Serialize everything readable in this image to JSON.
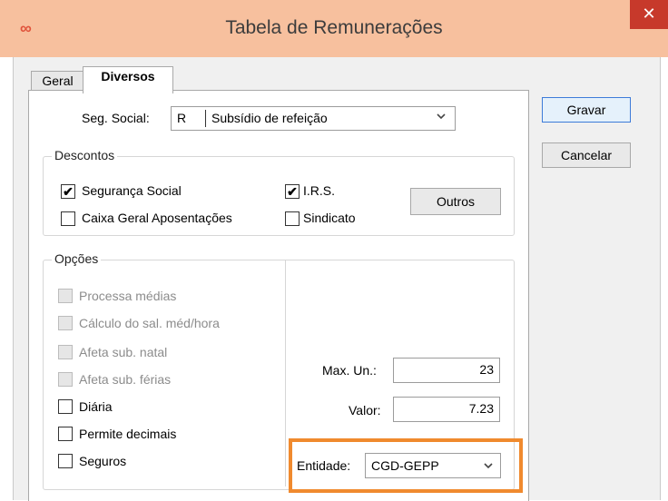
{
  "window": {
    "title": "Tabela de Remunerações",
    "logo": "∞",
    "close": "✕"
  },
  "tabs": [
    {
      "label": "Geral"
    },
    {
      "label": "Diversos"
    }
  ],
  "seg_social": {
    "label": "Seg. Social:",
    "code": "R",
    "value": "Subsídio de refeição"
  },
  "descontos": {
    "legend": "Descontos",
    "items": [
      {
        "label": "Segurança Social",
        "checked": true
      },
      {
        "label": "Caixa Geral Aposentações",
        "checked": false
      },
      {
        "label": "I.R.S.",
        "checked": true
      },
      {
        "label": "Sindicato",
        "checked": false
      }
    ],
    "outros_label": "Outros"
  },
  "opcoes": {
    "legend": "Opções",
    "items": [
      {
        "label": "Processa médias",
        "disabled": true
      },
      {
        "label": "Cálculo do sal. méd/hora",
        "disabled": true
      },
      {
        "label": "Afeta sub. natal",
        "disabled": true
      },
      {
        "label": "Afeta sub. férias",
        "disabled": true
      },
      {
        "label": "Diária",
        "disabled": false
      },
      {
        "label": "Permite decimais",
        "disabled": false
      },
      {
        "label": "Seguros",
        "disabled": false
      }
    ]
  },
  "max_un": {
    "label": "Max. Un.:",
    "value": "23"
  },
  "valor": {
    "label": "Valor:",
    "value": "7.23"
  },
  "entidade": {
    "label": "Entidade:",
    "value": "CGD-GEPP"
  },
  "buttons": {
    "gravar": "Gravar",
    "cancelar": "Cancelar"
  },
  "colors": {
    "highlight": "#f08a2e",
    "titlebar": "#f7c09e",
    "close": "#c7392b"
  }
}
